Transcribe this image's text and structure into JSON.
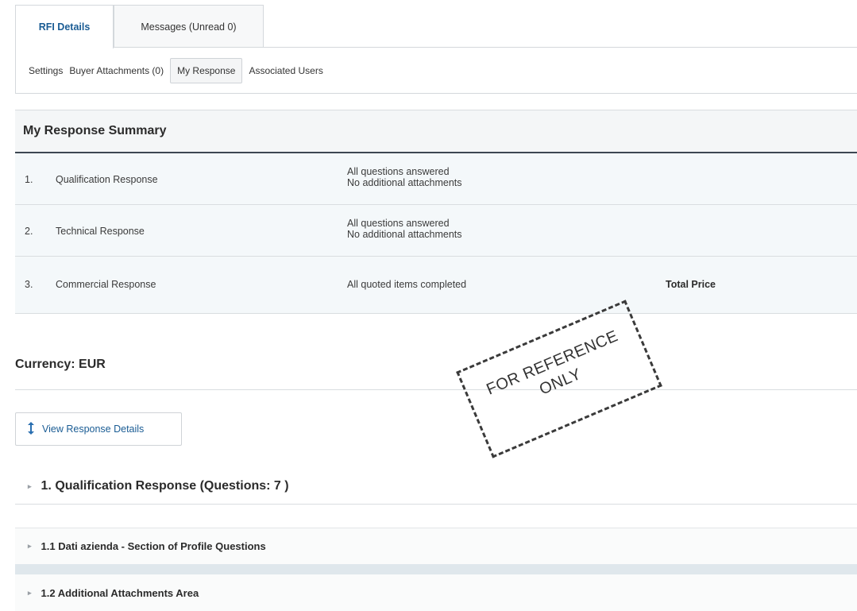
{
  "tabs": {
    "rfi_details": "RFI Details",
    "messages": "Messages (Unread 0)"
  },
  "subnav": {
    "settings": "Settings",
    "buyer_attachments": "Buyer Attachments (0)",
    "my_response": "My Response",
    "associated_users": "Associated Users"
  },
  "summary": {
    "title": "My Response Summary",
    "rows": [
      {
        "num": "1.",
        "name": "Qualification Response",
        "status_1": "All questions answered",
        "status_2": "No additional attachments",
        "extra": ""
      },
      {
        "num": "2.",
        "name": "Technical Response",
        "status_1": "All questions answered",
        "status_2": "No additional attachments",
        "extra": ""
      },
      {
        "num": "3.",
        "name": "Commercial Response",
        "status_1": "All quoted items completed",
        "status_2": "",
        "extra": "Total Price"
      }
    ]
  },
  "currency": "Currency: EUR",
  "view_button": {
    "label": "View Response Details",
    "icon": "expand-vertical-icon"
  },
  "sections": [
    {
      "label": "1. Qualification Response (Questions: 7 )"
    },
    {
      "label": "1.1  Dati azienda - Section of Profile Questions"
    },
    {
      "label": "1.2 Additional Attachments Area"
    }
  ],
  "stamp": {
    "line1": "FOR REFERENCE",
    "line2": "ONLY"
  },
  "colors": {
    "link_blue": "#1a5c94",
    "row_bg": "#f4f8fa",
    "header_rule": "#3d4752"
  }
}
